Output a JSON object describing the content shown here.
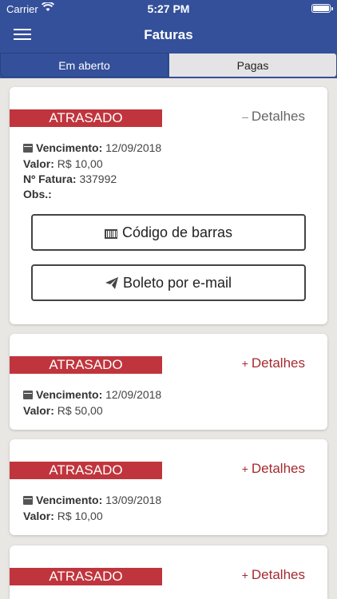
{
  "status": {
    "carrier": "Carrier",
    "time": "5:27 PM",
    "battery_level": 1.0
  },
  "header": {
    "title": "Faturas"
  },
  "tabs": [
    {
      "label": "Em aberto"
    },
    {
      "label": "Pagas"
    }
  ],
  "labels": {
    "vencimento": "Vencimento:",
    "valor": "Valor:",
    "fatura": "Nº Fatura:",
    "obs": "Obs.:",
    "detalhes": "Detalhes"
  },
  "invoices": [
    {
      "status": "ATRASADO",
      "toggle_sign": "–",
      "vencimento": "12/09/2018",
      "valor": "R$ 10,00",
      "fatura": "337992",
      "obs": "",
      "actions": {
        "barcode": "Código de barras",
        "email": "Boleto por e-mail"
      }
    },
    {
      "status": "ATRASADO",
      "toggle_sign": "+",
      "vencimento": "12/09/2018",
      "valor": "R$ 50,00"
    },
    {
      "status": "ATRASADO",
      "toggle_sign": "+",
      "vencimento": "13/09/2018",
      "valor": "R$ 10,00"
    },
    {
      "status": "ATRASADO",
      "toggle_sign": "+"
    }
  ],
  "colors": {
    "header": "#34509a",
    "badge": "#c0353d",
    "details_link": "#a52a30",
    "background": "#e9e7e3"
  },
  "icons": {
    "menu": "hamburger-icon",
    "calendar": "calendar-icon",
    "barcode": "barcode-icon",
    "send": "paper-plane-icon",
    "wifi": "wifi-icon",
    "battery": "battery-icon"
  }
}
